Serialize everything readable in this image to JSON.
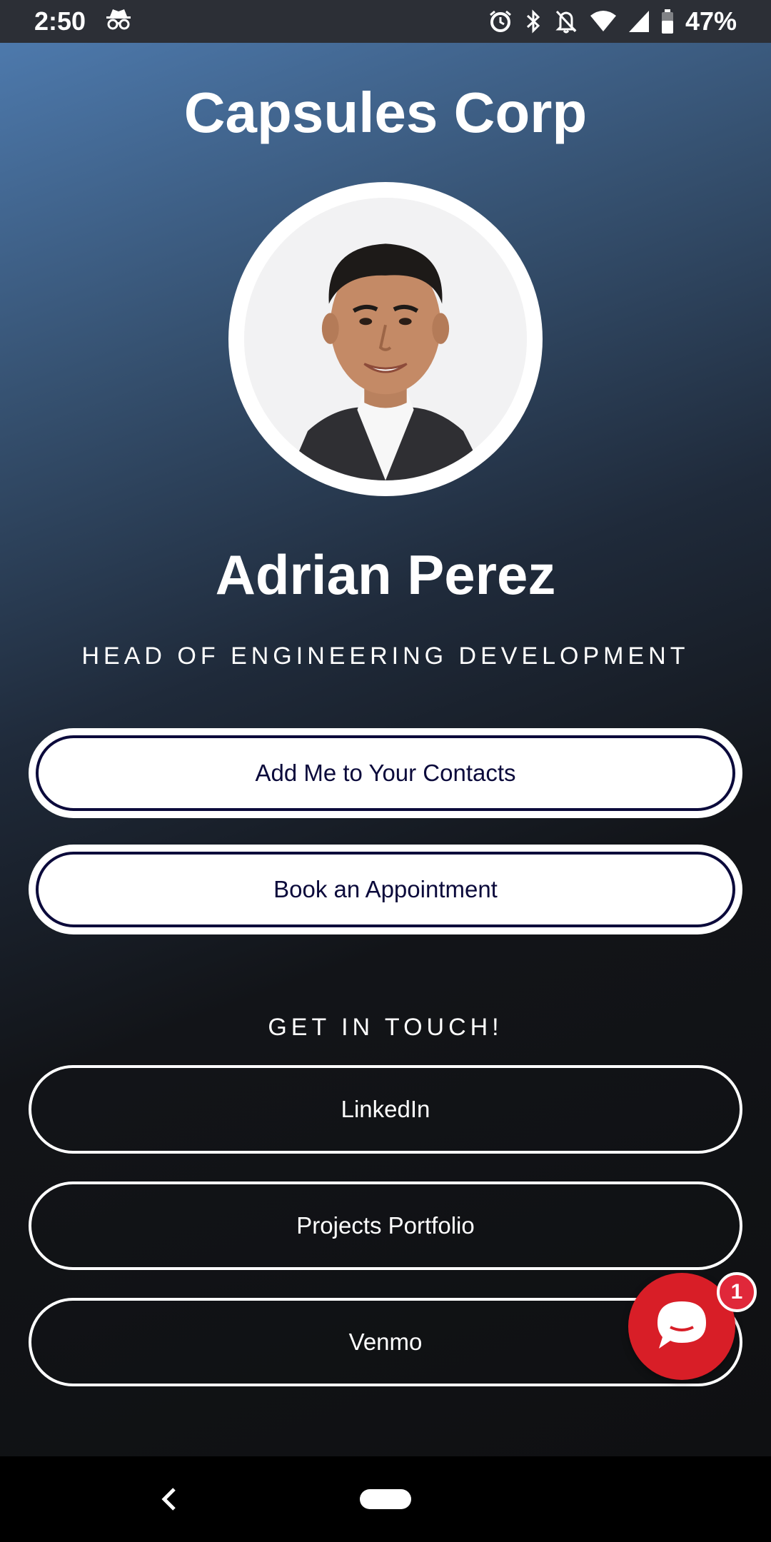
{
  "status_bar": {
    "time": "2:50",
    "battery": "47%",
    "icons": [
      "incognito-icon",
      "alarm-icon",
      "bluetooth-icon",
      "notifications-off-icon",
      "wifi-icon",
      "signal-icon",
      "battery-icon"
    ]
  },
  "header": {
    "company": "Capsules Corp"
  },
  "profile": {
    "name": "Adrian Perez",
    "title": "HEAD OF ENGINEERING DEVELOPMENT"
  },
  "actions": {
    "add_contact": "Add Me to Your Contacts",
    "book_appointment": "Book an Appointment"
  },
  "contact": {
    "section_title": "GET IN TOUCH!",
    "links": [
      "LinkedIn",
      "Projects Portfolio",
      "Venmo"
    ]
  },
  "chat": {
    "badge_count": "1"
  },
  "colors": {
    "accent_dark": "#0b0a3b",
    "chat_red": "#d81e27",
    "gradient_top": "#4d79ac",
    "gradient_bottom": "#0f1012"
  }
}
